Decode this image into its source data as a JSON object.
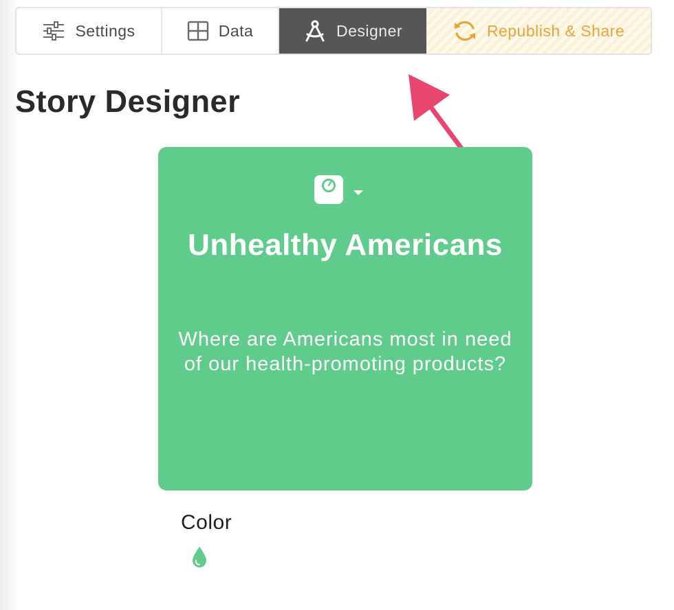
{
  "toolbar": {
    "tabs": [
      {
        "label": "Settings",
        "icon": "sliders-icon"
      },
      {
        "label": "Data",
        "icon": "grid-icon"
      },
      {
        "label": "Designer",
        "icon": "compass-icon",
        "active": true
      },
      {
        "label": "Republish & Share",
        "icon": "refresh-icon"
      }
    ]
  },
  "page": {
    "title": "Story Designer"
  },
  "card": {
    "icon": "scale-icon",
    "title": "Unhealthy Americans",
    "subtitle": "Where are Americans most in need of our health-promoting products?",
    "color": "#5fcc8c"
  },
  "color_section": {
    "label": "Color",
    "icon": "droplet-icon"
  },
  "colors": {
    "active_tab_bg": "#565656",
    "republish_text": "#e8a43a",
    "arrow": "#e8466e"
  }
}
